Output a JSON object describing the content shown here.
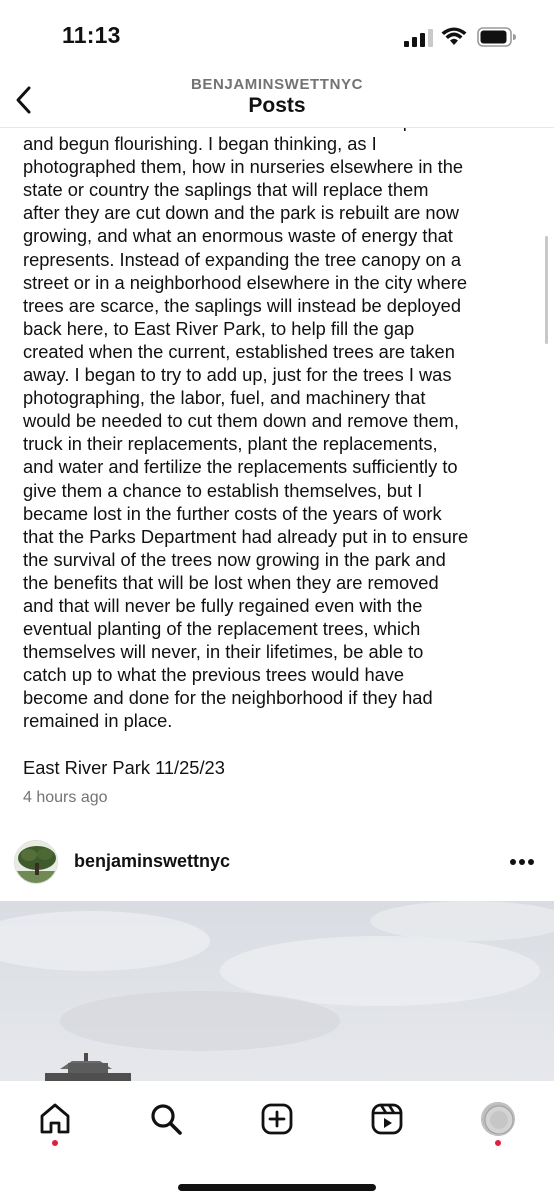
{
  "status_bar": {
    "time": "11:13",
    "icons": [
      "signal-icon",
      "wifi-icon",
      "battery-icon"
    ]
  },
  "header": {
    "subtitle": "BENJAMINSWETTNYC",
    "title": "Posts",
    "back_icon": "chevron-left-icon"
  },
  "caption": {
    "text": "have established themselves in their different spots\nand begun flourishing. I began thinking, as I\nphotographed them, how in nurseries elsewhere in the\nstate or country the saplings that will replace them\nafter they are cut down and the park is rebuilt are now\ngrowing, and what an enormous waste of energy that\nrepresents. Instead of expanding the tree canopy on a\nstreet or in a neighborhood elsewhere in the city where\ntrees are scarce, the saplings will instead be deployed\nback here, to East River Park, to help fill the gap\ncreated when the current, established trees are taken\naway. I began to try to add up, just for the trees I was\nphotographing, the labor, fuel, and machinery that\nwould be needed to cut them down and remove them,\ntruck in their replacements, plant the replacements,\nand water and fertilize the replacements sufficiently to\ngive them a chance to establish themselves, but I\nbecame lost in the further costs of the years of work\nthat the Parks Department had already put in to ensure\nthe survival of the trees now growing in the park and\nthe benefits that will be lost when they are removed\nand that will never be fully regained even with the\neventual planting of the replacement trees, which\nthemselves will never, in their lifetimes, be able to\ncatch up to what the previous trees would have\nbecome and done for the neighborhood if they had\nremained in place.",
    "location_line": "East River Park 11/25/23",
    "time_ago": "4 hours ago"
  },
  "next_post": {
    "username": "benjaminswettnyc",
    "more_icon": "more-horizontal-icon"
  },
  "bottom_nav": {
    "items": [
      {
        "name": "home",
        "icon": "home-icon",
        "has_dot": true
      },
      {
        "name": "search",
        "icon": "search-icon",
        "has_dot": false
      },
      {
        "name": "create",
        "icon": "plus-square-icon",
        "has_dot": false
      },
      {
        "name": "reels",
        "icon": "reels-icon",
        "has_dot": false
      },
      {
        "name": "profile",
        "icon": "profile-avatar",
        "has_dot": true
      }
    ]
  },
  "colors": {
    "text": "#111111",
    "secondary_text": "#737373",
    "notification_dot": "#e41e3f",
    "background": "#ffffff"
  }
}
